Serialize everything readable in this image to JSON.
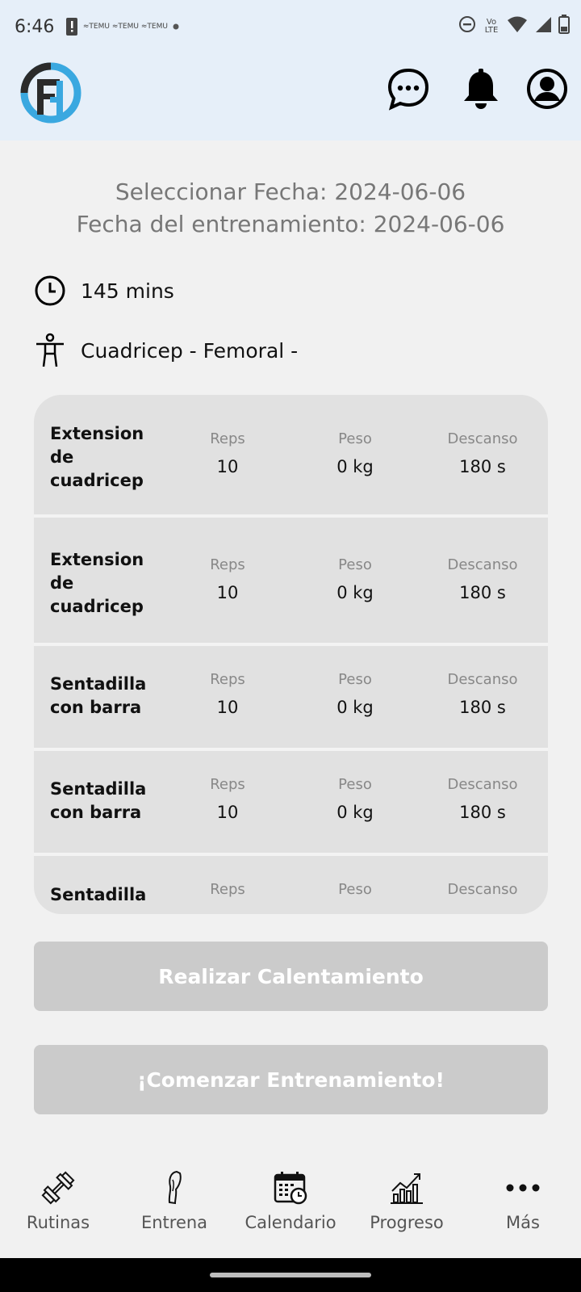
{
  "status_bar": {
    "time": "6:46",
    "notification_icons": [
      "alert-icon",
      "temu-icon",
      "temu-icon",
      "temu-icon"
    ],
    "temu_label": "TEMU",
    "volte": "Vo LTE",
    "right_icons": [
      "dnd-icon",
      "volte-icon",
      "wifi-icon",
      "signal-icon",
      "battery-icon"
    ]
  },
  "header": {
    "logo": "FA",
    "icons": [
      "chat-icon",
      "bell-icon",
      "account-icon"
    ]
  },
  "dates": {
    "selected_line": "Seleccionar Fecha: 2024-06-06",
    "training_line": "Fecha del entrenamiento: 2024-06-06"
  },
  "summary": {
    "duration": "145 mins",
    "muscles": "Cuadricep - Femoral -"
  },
  "exercises": {
    "labels": {
      "reps": "Reps",
      "weight": "Peso",
      "rest": "Descanso"
    },
    "items": [
      {
        "name": "Extension de cuadricep",
        "reps": "10",
        "weight": "0 kg",
        "rest": "180 s"
      },
      {
        "name": "Extension de cuadricep",
        "reps": "10",
        "weight": "0 kg",
        "rest": "180 s"
      },
      {
        "name": "Sentadilla con barra",
        "reps": "10",
        "weight": "0 kg",
        "rest": "180 s"
      },
      {
        "name": "Sentadilla con barra",
        "reps": "10",
        "weight": "0 kg",
        "rest": "180 s"
      },
      {
        "name": "Sentadilla",
        "reps": "",
        "weight": "",
        "rest": ""
      }
    ]
  },
  "buttons": {
    "warmup": "Realizar Calentamiento",
    "start": "¡Comenzar Entrenamiento!"
  },
  "bottom_nav": [
    {
      "label": "Rutinas",
      "icon": "dumbbell-icon"
    },
    {
      "label": "Entrena",
      "icon": "leg-icon"
    },
    {
      "label": "Calendario",
      "icon": "calendar-icon"
    },
    {
      "label": "Progreso",
      "icon": "chart-icon"
    },
    {
      "label": "Más",
      "icon": "more-icon"
    }
  ],
  "colors": {
    "header_bg": "#e6eff9",
    "logo_blue": "#3aa8e0",
    "button_disabled": "#cbcbcb",
    "card_bg": "#e1e1e1"
  }
}
